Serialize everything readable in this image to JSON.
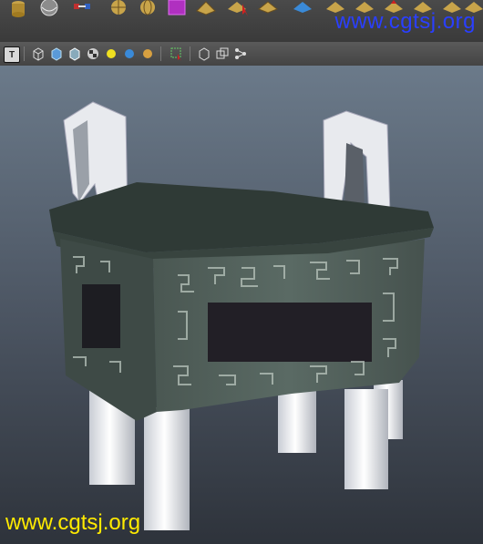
{
  "shelf": {
    "icons": [
      "cylinder-icon",
      "sphere-icon",
      "dumbbell-icon",
      "cube-grid-icon",
      "globe-icon",
      "texture-cube-icon",
      "plane-icon",
      "select-arrow-icon",
      "plane-icon",
      "sculpt-icon",
      "plane-icon",
      "plane-icon",
      "move-icon",
      "plane-icon",
      "plane-icon",
      "plane-icon"
    ]
  },
  "watermark_top": "www.cgtsj.org",
  "watermark_bottom": "www.cgtsj.org",
  "toolbar": {
    "text_toggle": "T",
    "icons": [
      "wireframe-icon",
      "smooth-shade-icon",
      "shade-wire-icon",
      "checker-icon",
      "default-light-icon",
      "all-lights-icon",
      "sun-light-icon",
      "select-mode-icon",
      "isolate-icon",
      "xray-icon",
      "joints-icon"
    ]
  },
  "colors": {
    "watermark_top": "#2a3fff",
    "watermark_bottom": "#ffea00",
    "bronze": "#3e4a46"
  }
}
